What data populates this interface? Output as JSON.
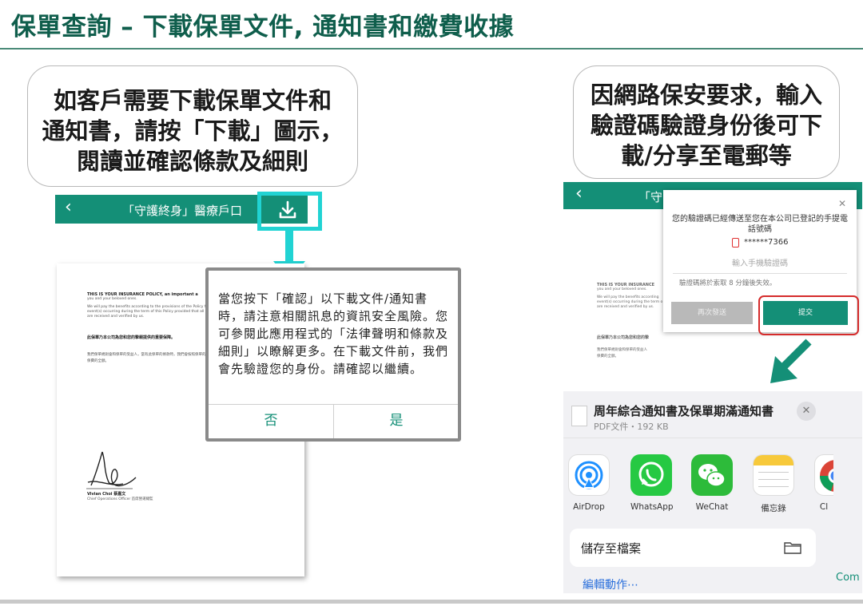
{
  "title": "保單查詢 – 下載保單文件, 通知書和繳費收據",
  "callouts": {
    "left": [
      "如客戶需要下載保單文件和",
      "通知書，請按「下載」圖示，",
      "閱讀並確認條款及細則"
    ],
    "right": [
      "因網路保安要求，輸入",
      "驗證碼驗證身份後可下",
      "載/分享至電郵等"
    ]
  },
  "left_phone": {
    "back_icon": "chevron-left-icon",
    "header_title": "「守護終身」醫療戶口",
    "download_icon": "download-icon",
    "document": {
      "lines": [
        "THIS IS YOUR INSURANCE POLICY, an important a",
        "you and your beloved ones.",
        "We will pay the benefits according to the provisions of the Policy fo",
        "event(s) occurring during the term of this Policy provided that all rec",
        "are received and verified by us.",
        "此保單乃本公司為您和您的摯親提供的重要保障。",
        "我們保單規則會和保單的受益人，當有此保單的條款時，我們會按照保單的條",
        "保費的全額。"
      ],
      "signer_name": "Vivian Choi 蔡嘉文",
      "signer_title": "Chief Operations Officer 首席營運總監"
    },
    "dialog": {
      "message": "當您按下「確認」以下載文件/通知書時，請注意相關訊息的資訊安全風險。您可參閱此應用程式的「法律聲明和條款及細則」以瞭解更多。在下載文件前，我們會先驗證您的身份。請確認以繼續。",
      "no": "否",
      "yes": "是"
    }
  },
  "right_phone": {
    "header_title": "「守",
    "doc_lines": [
      "THIS IS YOUR INSURANCE",
      "you and your beloved ones.",
      "We will pay the benefits according",
      "event(s) occurring during the term o",
      "are received and verified by us.",
      "此保單乃本公司為您和您的摯",
      "我們保單規則會和保單的受益人",
      "保費的全額。"
    ],
    "verify": {
      "message": "您的驗證碼已經傳送至您在本公司已登記的手提電話號碼",
      "phone": "******7366",
      "placeholder": "輸入手機驗證碼",
      "expiry": "驗證碼將於索取 8 分鐘後失效。",
      "resend": "再次發送",
      "submit": "提交"
    },
    "share": {
      "file_title": "周年綜合通知書及保單期滿通知書",
      "file_meta": "PDF文件・192 KB",
      "apps": [
        {
          "name": "AirDrop",
          "icon": "airdrop-icon"
        },
        {
          "name": "WhatsApp",
          "icon": "whatsapp-icon"
        },
        {
          "name": "WeChat",
          "icon": "wechat-icon"
        },
        {
          "name": "備忘錄",
          "icon": "notes-icon"
        },
        {
          "name": "Cl",
          "icon": "chrome-icon"
        }
      ],
      "save_to_files": "儲存至檔案",
      "edit_actions": "編輯動作⋯"
    }
  },
  "footer_text": "Com",
  "colors": {
    "brand_green": "#148f77",
    "title_green": "#0f5e4c",
    "highlight_cyan": "#21d3d3",
    "alert_red": "#d52b2b"
  }
}
